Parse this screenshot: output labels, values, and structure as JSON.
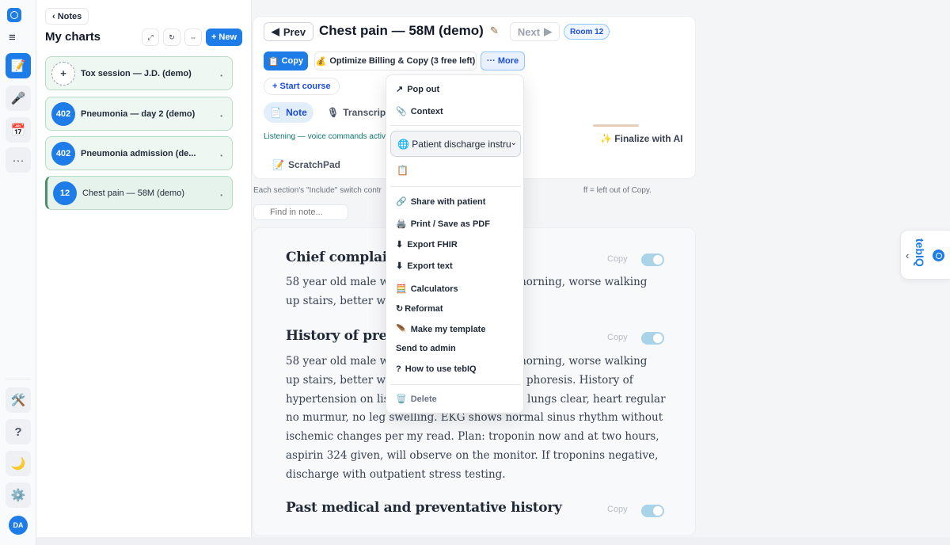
{
  "rail": {
    "items": [
      {
        "name": "notes",
        "icon": "📝"
      },
      {
        "name": "record",
        "icon": "🎤"
      },
      {
        "name": "calendar",
        "icon": "📅"
      },
      {
        "name": "more",
        "icon": "···"
      }
    ],
    "bottom": [
      {
        "name": "tools",
        "icon": "🛠️"
      },
      {
        "name": "help",
        "icon": "?"
      },
      {
        "name": "theme",
        "icon": "🌙"
      },
      {
        "name": "settings",
        "icon": "⚙️"
      }
    ],
    "avatar": "DA"
  },
  "notes_panel": {
    "back_label": "‹ Notes",
    "title": "My charts",
    "new_label": "+ New",
    "tools": [
      "⤢",
      "↻",
      "⇔"
    ],
    "charts": [
      {
        "badge": "+",
        "label": "Tox session — J.D. (demo)"
      },
      {
        "badge": "402",
        "label": "Pneumonia — day 2 (demo)"
      },
      {
        "badge": "402",
        "label": "Pneumonia admission (de..."
      },
      {
        "badge": "12",
        "label": "Chest pain — 58M (demo)"
      }
    ]
  },
  "header": {
    "prev_label": "Prev",
    "title": "Chest pain — 58M (demo)",
    "next_label": "Next",
    "room_badge": "Room 12",
    "copy_label": "Copy",
    "optimize_label": "Optimize Billing & Copy (3 free left)",
    "more_label": "··· More",
    "start_course_label": "+ Start course",
    "tab_note": "Note",
    "tab_transcript": "Transcript",
    "listening_text": "Listening — voice commands activ",
    "finalize_label": "✨ Finalize with AI",
    "scratchpad_label": "ScratchPad"
  },
  "info_line": "Each section's \"Include\" switch contr",
  "info_line_tail": "ff = left out of Copy.",
  "find_placeholder": "Find in note...",
  "sections": [
    {
      "title": "Chief complain",
      "body_lines": [
        "58 year old male wit",
        "up stairs, better wit"
      ],
      "body_right": [
        "morning, worse walking",
        ""
      ],
      "copy_label": "Copy"
    },
    {
      "title": "History of prese",
      "body_lines": [
        "58 year old male wit",
        "up stairs, better wit",
        "hypertension on lisi",
        "no murmur, no leg swelling. EKG shows normal sinus rhythm without",
        "ischemic changes per my read. Plan: troponin now and at two hours,",
        "aspirin 324 given, will observe on the monitor. If troponins negative,",
        "discharge with outpatient stress testing."
      ],
      "body_right": [
        "morning, worse walking",
        "phoresis. History of",
        "lungs clear, heart regular"
      ],
      "copy_label": "Copy"
    },
    {
      "title": "Past medical and preventative history",
      "copy_label": "Copy"
    }
  ],
  "more_menu": {
    "items_top": [
      {
        "icon": "↗",
        "label": "Pop out"
      },
      {
        "icon": "📎",
        "label": "Context"
      }
    ],
    "language_value": "🌐 Patient discharge instru",
    "items_bottom": [
      {
        "icon": "🔗",
        "label": "Share with patient"
      },
      {
        "icon": "🖨️",
        "label": "Print / Save as PDF"
      },
      {
        "icon": "⬇",
        "label": "Export FHIR"
      },
      {
        "icon": "⬇",
        "label": "Export text"
      },
      {
        "icon": "🧮",
        "label": "Calculators"
      },
      {
        "icon": "↻",
        "label": "Reformat"
      },
      {
        "icon": "🪶",
        "label": "Make my template"
      },
      {
        "icon": "",
        "label": "Send to admin"
      },
      {
        "icon": "?",
        "label": "How to use tebIQ"
      }
    ],
    "delete_label": "Delete"
  },
  "widget": {
    "brand": "tebIQ"
  },
  "colors": {
    "accent": "#1d7ce8",
    "card_green": "#eef7f2",
    "toggle": "#a9d3e6"
  }
}
